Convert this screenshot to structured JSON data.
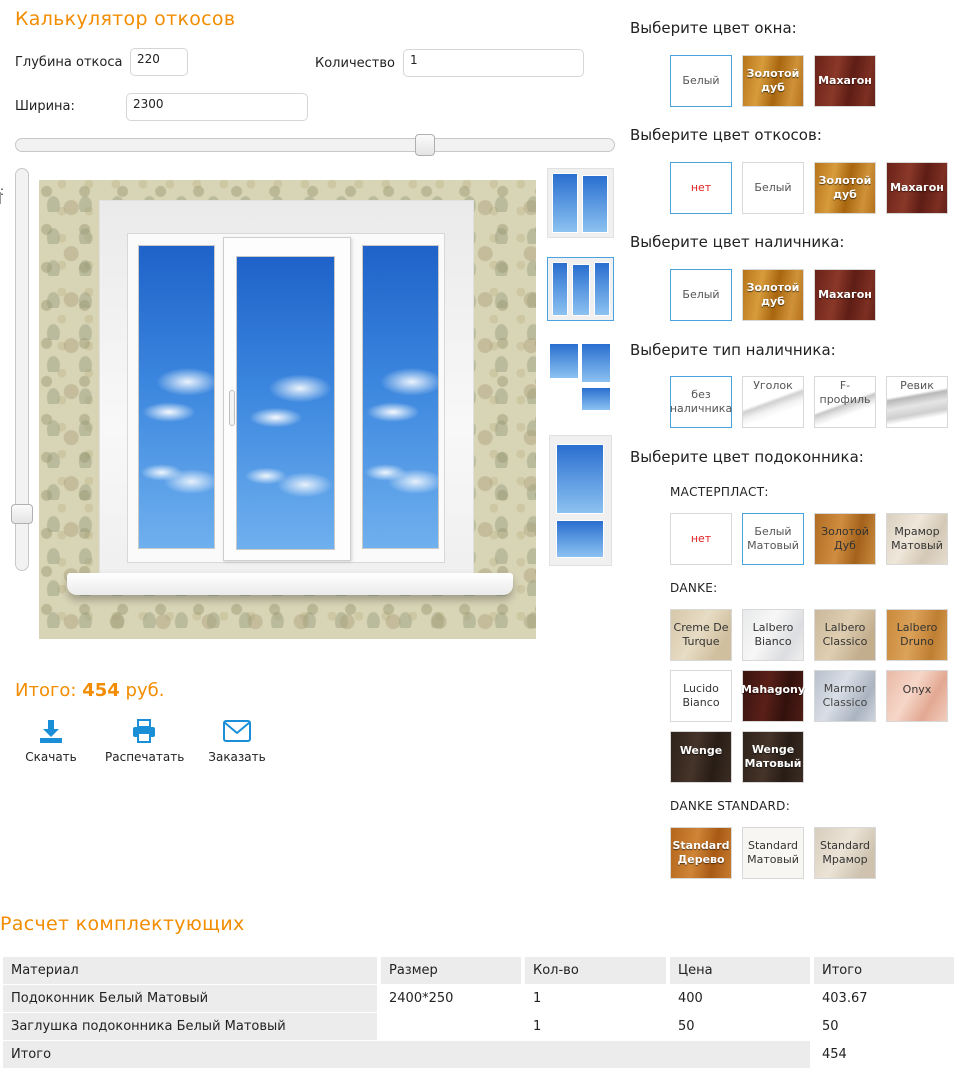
{
  "header": {
    "title": "Калькулятор откосов"
  },
  "form": {
    "depth_label": "Глубина откоса",
    "depth_value": "220",
    "quantity_label": "Количество",
    "quantity_value": "1",
    "width_label": "Ширина:",
    "width_value": "2300",
    "vertical_slider_label": ":"
  },
  "total": {
    "label": "Итого:",
    "amount": "454",
    "currency": "руб."
  },
  "actions": {
    "download": "Скачать",
    "print": "Распечатать",
    "order": "Заказать"
  },
  "options": {
    "window_color": {
      "title": "Выберите цвет окна:",
      "items": [
        "Белый",
        "Золотой дуб",
        "Махагон"
      ]
    },
    "slope_color": {
      "title": "Выберите цвет откосов:",
      "items": [
        "нет",
        "Белый",
        "Золотой дуб",
        "Махагон"
      ]
    },
    "trim_color": {
      "title": "Выберите цвет наличника:",
      "items": [
        "Белый",
        "Золотой дуб",
        "Махагон"
      ]
    },
    "trim_type": {
      "title": "Выберите тип наличника:",
      "items": [
        "без наличника",
        "Уголок",
        "F-профиль",
        "Ревик"
      ]
    },
    "sill_color": {
      "title": "Выберите цвет подоконника:",
      "masterplast": {
        "label": "МАСТЕРПЛАСТ:",
        "items": [
          "нет",
          "Белый Матовый",
          "Золотой Дуб",
          "Мрамор Матовый"
        ]
      },
      "danke": {
        "label": "DANKE:",
        "items": [
          "Creme De Turque",
          "Lalbero Bianco",
          "Lalbero Classico",
          "Lalbero Druno",
          "Lucido Bianco",
          "Mahagony",
          "Marmor Classico",
          "Onyx",
          "Wenge",
          "Wenge Матовый"
        ]
      },
      "danke_standard": {
        "label": "DANKE STANDARD:",
        "items": [
          "Standard Дерево",
          "Standard Матовый",
          "Standard Мрамор"
        ]
      }
    }
  },
  "calc": {
    "title": "Расчет комплектующих",
    "columns": [
      "Материал",
      "Размер",
      "Кол-во",
      "Цена",
      "Итого"
    ],
    "rows": [
      [
        "Подоконник Белый Матовый",
        "2400*250",
        "1",
        "400",
        "403.67"
      ],
      [
        "Заглушка подоконника Белый Матовый",
        "",
        "1",
        "50",
        "50"
      ]
    ],
    "footer": {
      "label": "Итого",
      "value": "454"
    }
  },
  "colors": {
    "accent": "#f28c00",
    "selected_border": "#4aa3df",
    "icon_blue": "#1a8fd8"
  }
}
